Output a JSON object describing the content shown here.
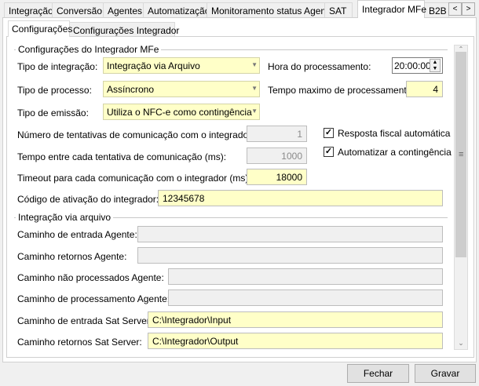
{
  "main_tabs": [
    "Integração",
    "Conversão",
    "Agentes",
    "Automatização",
    "Monitoramento status Agente",
    "SAT",
    "Integrador MFe",
    "B2B"
  ],
  "tab_scroll": {
    "left": "<",
    "right": ">"
  },
  "sub_tabs": [
    "Configurações",
    "Configurações Integrador"
  ],
  "group1": {
    "title": "Configurações do Integrador MFe",
    "tipo_integracao": {
      "label": "Tipo de integração:",
      "value": "Integração via Arquivo"
    },
    "hora": {
      "label": "Hora do processamento:",
      "value": "20:00:00"
    },
    "tipo_processo": {
      "label": "Tipo de processo:",
      "value": "Assíncrono"
    },
    "tempo_max": {
      "label": "Tempo maximo de processamento:",
      "value": "4"
    },
    "tipo_emissao": {
      "label": "Tipo de emissão:",
      "value": "Utiliza o NFC-e como contingência"
    },
    "tentativas": {
      "label": "Número de tentativas de comunicação com o integrador:",
      "value": "1"
    },
    "tempo_entre": {
      "label": "Tempo entre cada tentativa de comunicação (ms):",
      "value": "1000"
    },
    "timeout": {
      "label": "Timeout para cada comunicação com o integrador (ms):",
      "value": "18000"
    },
    "codigo": {
      "label": "Código de ativação do integrador:",
      "value": "12345678"
    },
    "resposta_fiscal": {
      "label": "Resposta fiscal automática",
      "checked": true
    },
    "automatizar": {
      "label": "Automatizar a contingência",
      "checked": true
    }
  },
  "group2": {
    "title": "Integração via arquivo",
    "fields": [
      {
        "label": "Caminho de entrada Agente:",
        "value": ""
      },
      {
        "label": "Caminho retornos Agente:",
        "value": ""
      },
      {
        "label": "Caminho não processados Agente:",
        "value": ""
      },
      {
        "label": "Caminho de processamento Agente:",
        "value": ""
      },
      {
        "label": "Caminho de entrada Sat Server:",
        "value": "C:\\Integrador\\Input"
      },
      {
        "label": "Caminho retornos Sat Server:",
        "value": "C:\\Integrador\\Output"
      }
    ]
  },
  "buttons": {
    "close": "Fechar",
    "save": "Gravar"
  }
}
